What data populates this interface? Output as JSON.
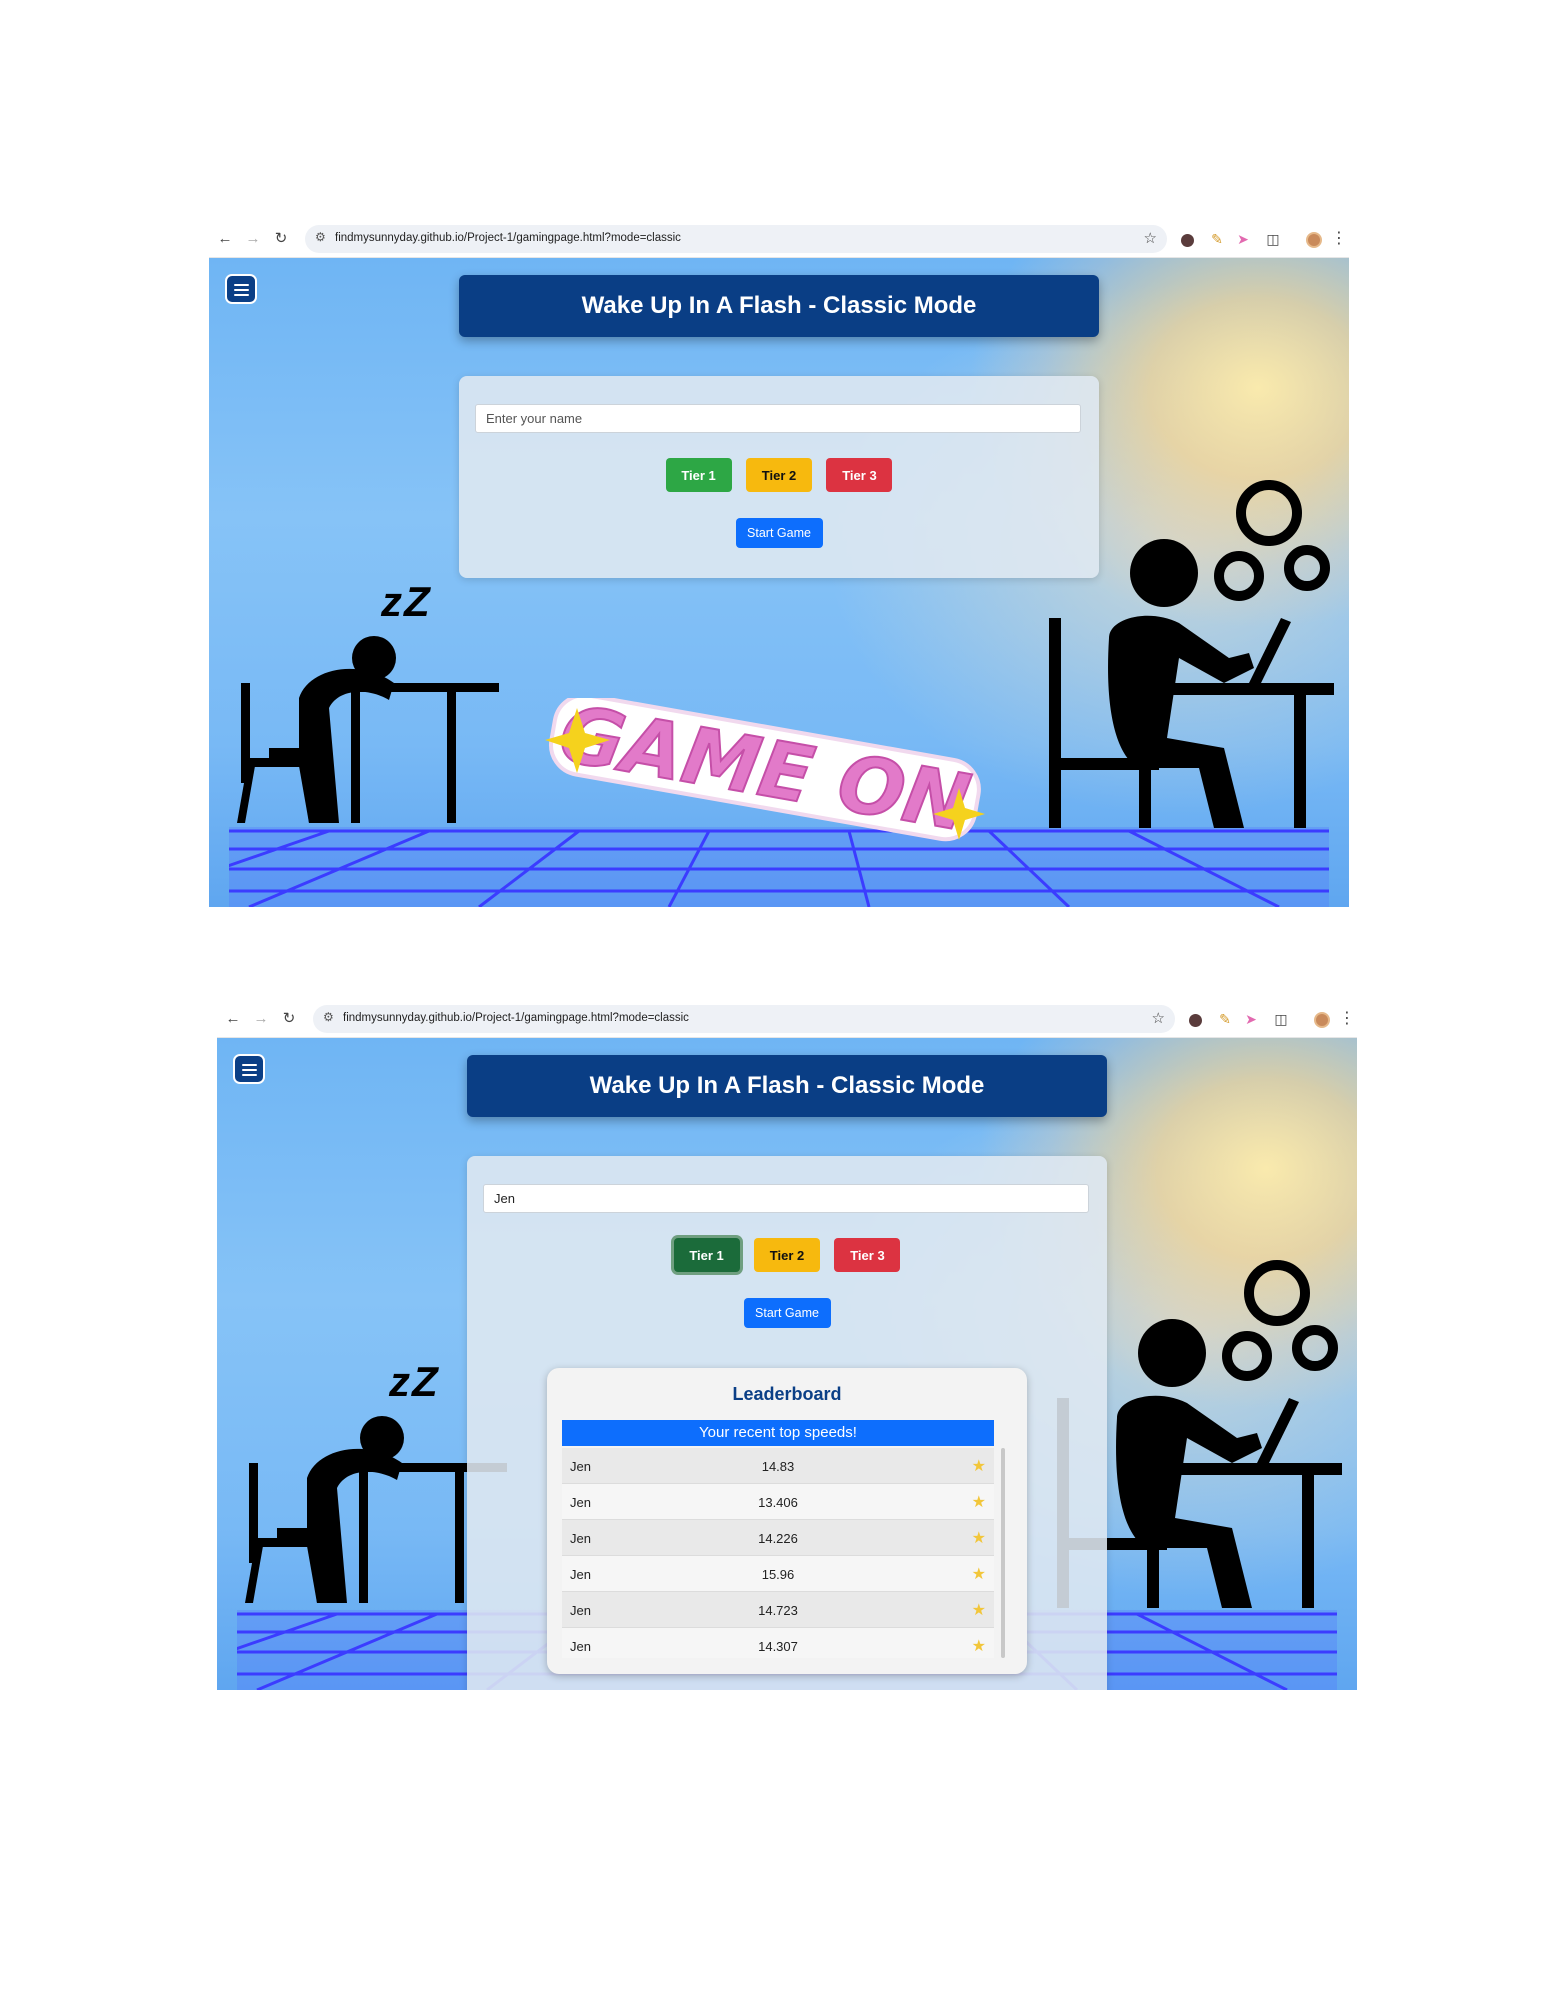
{
  "browser": {
    "url": "findmysunnyday.github.io/Project-1/gamingpage.html?mode=classic",
    "back_icon": "arrow-left-icon",
    "forward_icon": "arrow-right-icon",
    "reload_icon": "reload-icon",
    "bookmark_icon": "star-outline-icon"
  },
  "page": {
    "title": "Wake Up In A Flash - Classic Mode",
    "sticker_text": "GAME ON",
    "sleep_text": "zZ"
  },
  "screen1": {
    "name_value": "",
    "name_placeholder": "Enter your name",
    "tiers": [
      "Tier 1",
      "Tier 2",
      "Tier 3"
    ],
    "start_label": "Start Game"
  },
  "screen2": {
    "name_value": "Jen",
    "name_placeholder": "Enter your name",
    "tiers": [
      "Tier 1",
      "Tier 2",
      "Tier 3"
    ],
    "active_tier": "Tier 1",
    "start_label": "Start Game",
    "leaderboard": {
      "title": "Leaderboard",
      "header": "Your recent top speeds!",
      "rows": [
        {
          "name": "Jen",
          "speed": "14.83"
        },
        {
          "name": "Jen",
          "speed": "13.406"
        },
        {
          "name": "Jen",
          "speed": "14.226"
        },
        {
          "name": "Jen",
          "speed": "15.96"
        },
        {
          "name": "Jen",
          "speed": "14.723"
        },
        {
          "name": "Jen",
          "speed": "14.307"
        }
      ],
      "row_icon": "star-icon"
    }
  },
  "colors": {
    "title_bg": "#0a3e85",
    "tier1": "#2da745",
    "tier1_active": "#1b6b3a",
    "tier2": "#f7b90e",
    "tier3": "#dc3341",
    "start": "#0d6efd",
    "sticker_pink": "#e27ac9"
  }
}
